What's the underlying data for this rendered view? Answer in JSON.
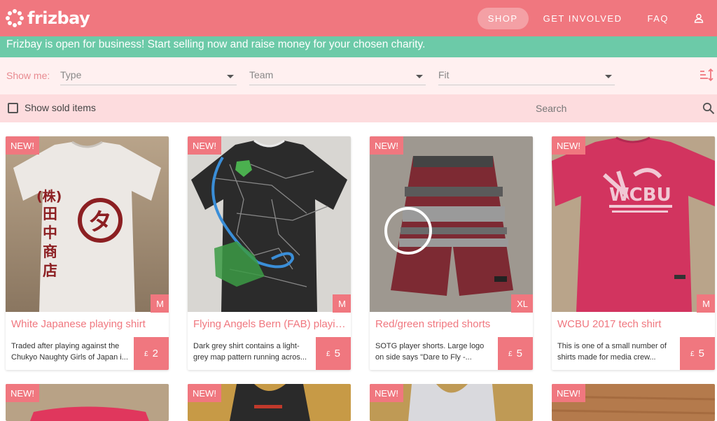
{
  "header": {
    "logo_text": "frizbay",
    "nav": [
      {
        "label": "SHOP",
        "active": true
      },
      {
        "label": "GET INVOLVED",
        "active": false
      },
      {
        "label": "FAQ",
        "active": false
      }
    ],
    "user_icon": "user-icon"
  },
  "banner": {
    "text": "Frizbay is open for business! Start selling now and raise money for your chosen charity."
  },
  "filters": {
    "show_me_label": "Show me:",
    "type_label": "Type",
    "team_label": "Team",
    "fit_label": "Fit",
    "sort_icon": "sort-icon"
  },
  "search": {
    "show_sold_label": "Show sold items",
    "placeholder": "Search",
    "search_icon": "search-icon"
  },
  "cards": [
    {
      "badge": "NEW!",
      "size": "M",
      "title": "White Japanese playing shirt",
      "desc": "Traded after playing against the Chukyo Naughty Girls of Japan i...",
      "currency": "£",
      "price": "2"
    },
    {
      "badge": "NEW!",
      "size": "M",
      "title": "Flying Angels Bern (FAB) playing shirt",
      "desc": "Dark grey shirt contains a light-grey map pattern running acros...",
      "currency": "£",
      "price": "5"
    },
    {
      "badge": "NEW!",
      "size": "XL",
      "title": "Red/green striped shorts",
      "desc": "SOTG player shorts. Large logo on side says \"Dare to Fly -...",
      "currency": "£",
      "price": "5"
    },
    {
      "badge": "NEW!",
      "size": "M",
      "title": "WCBU 2017 tech shirt",
      "desc": "This is one of a small number of shirts made for media crew...",
      "currency": "£",
      "price": "5"
    }
  ],
  "second_row": [
    {
      "badge": "NEW!"
    },
    {
      "badge": "NEW!"
    },
    {
      "badge": "NEW!"
    },
    {
      "badge": "NEW!"
    }
  ],
  "colors": {
    "brand": "#f0777f",
    "banner": "#6ccaa8",
    "filter_bg": "#fff0f0",
    "search_bg": "#fddcde"
  }
}
